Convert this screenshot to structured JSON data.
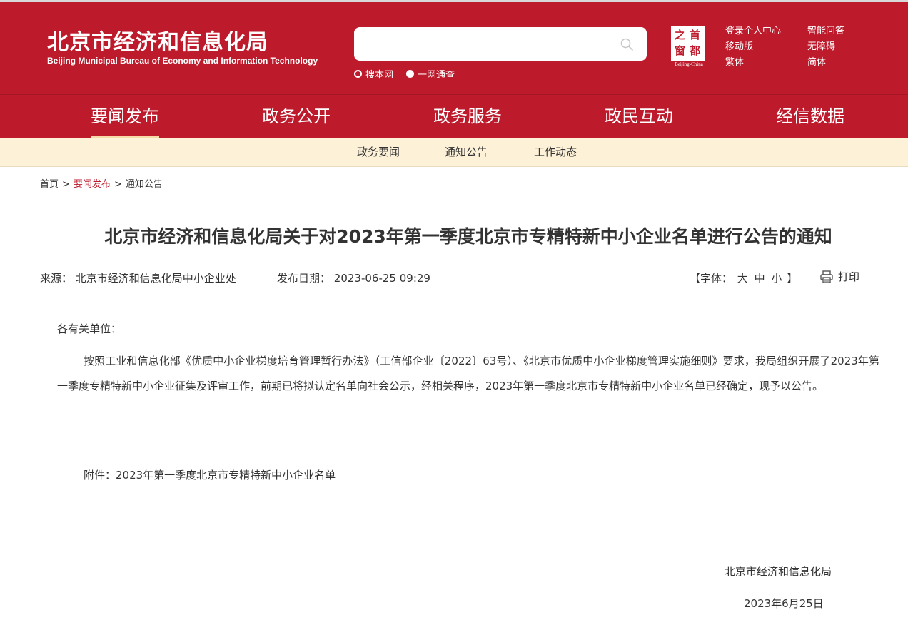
{
  "header": {
    "title_cn": "北京市经济和信息化局",
    "title_en": "Beijing Municipal Bureau of Economy and Information Technology",
    "search": {
      "placeholder": "",
      "value": ""
    },
    "scope_options": [
      "搜本网",
      "一网通查"
    ],
    "scope_selected": "一网通查",
    "capital_logo": {
      "chars": [
        "首",
        "都",
        "之",
        "窗"
      ],
      "caption": "Beijing-China"
    },
    "links_col1": [
      "登录个人中心",
      "移动版",
      "繁体"
    ],
    "links_col2": [
      "智能问答",
      "无障碍",
      "简体"
    ]
  },
  "nav": {
    "items": [
      "要闻发布",
      "政务公开",
      "政务服务",
      "政民互动",
      "经信数据"
    ],
    "active": "要闻发布"
  },
  "subnav": {
    "items": [
      "政务要闻",
      "通知公告",
      "工作动态"
    ]
  },
  "breadcrumb": [
    "首页",
    "要闻发布",
    "通知公告"
  ],
  "article": {
    "title": "北京市经济和信息化局关于对2023年第一季度北京市专精特新中小企业名单进行公告的通知",
    "source_label": "来源：",
    "source": "北京市经济和信息化局中小企业处",
    "date_label": "发布日期：",
    "date": "2023-06-25 09:29",
    "font_label_open": "【字体：",
    "font_sizes": [
      "大",
      "中",
      "小"
    ],
    "font_label_close": "】",
    "print_label": "打印",
    "salutation": "各有关单位：",
    "paragraph": "按照工业和信息化部《优质中小企业梯度培育管理暂行办法》（工信部企业〔2022〕63号）、《北京市优质中小企业梯度管理实施细则》要求，我局组织开展了2023年第一季度专精特新中小企业征集及评审工作，前期已将拟认定名单向社会公示，经相关程序，2023年第一季度北京市专精特新中小企业名单已经确定，现予以公告。",
    "attachment": "附件：2023年第一季度北京市专精特新中小企业名单",
    "signature_org": "北京市经济和信息化局",
    "signature_date": "2023年6月25日"
  },
  "colors": {
    "brand_red": "#bd1b2c",
    "subnav_bg": "#fdf1d8",
    "active_underline": "#f5d9a6"
  }
}
